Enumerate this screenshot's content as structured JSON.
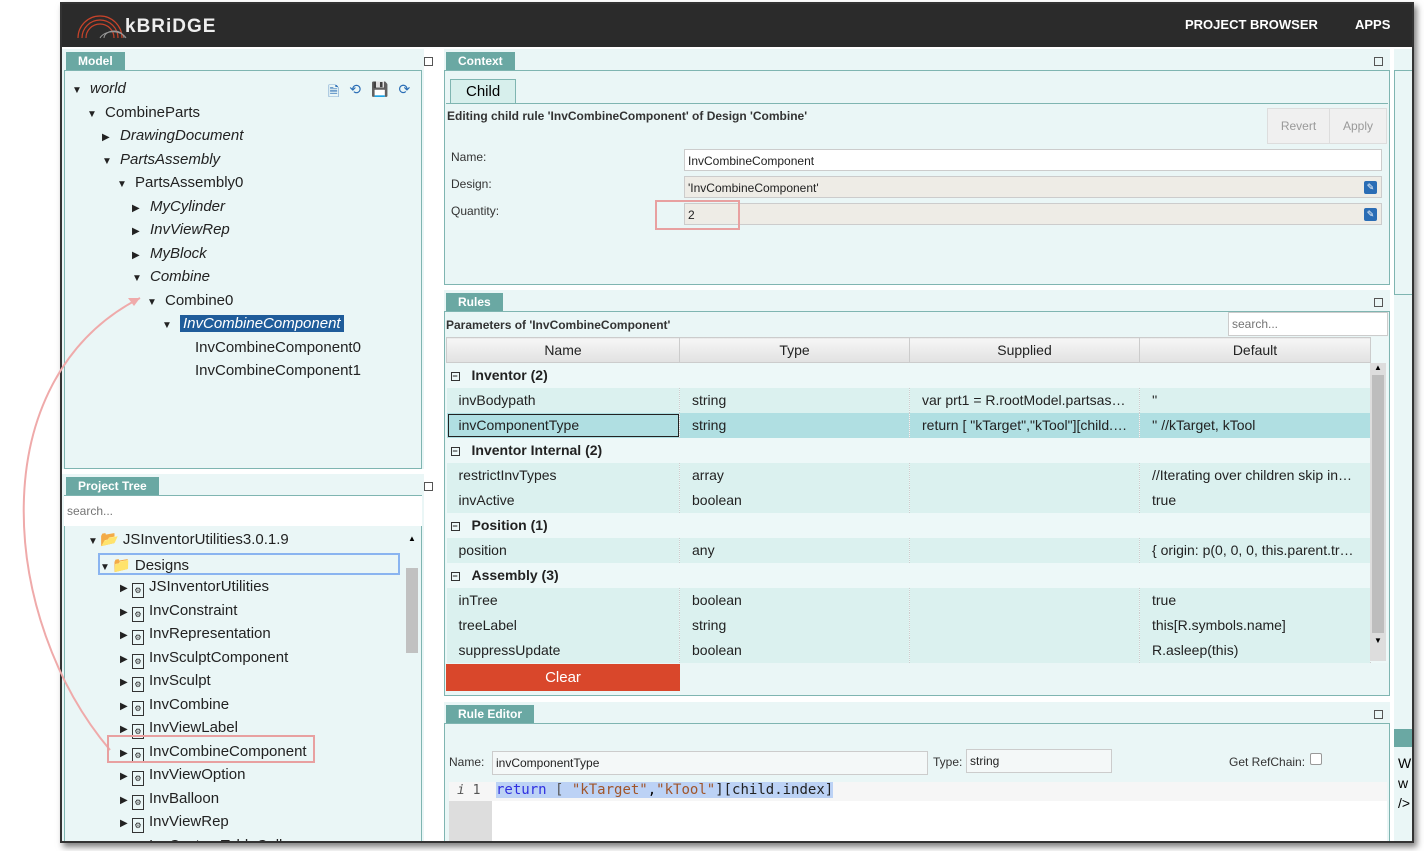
{
  "header": {
    "brand": "kBRiDGE",
    "nav": [
      "PROJECT BROWSER",
      "APPS"
    ]
  },
  "model": {
    "tab": "Model",
    "icons": [
      "code-file-icon",
      "history-icon",
      "save-icon",
      "refresh-icon"
    ],
    "nodes": [
      {
        "label": "world",
        "level": 0,
        "exp": "down",
        "italic": true
      },
      {
        "label": "CombineParts",
        "level": 1,
        "exp": "down"
      },
      {
        "label": "DrawingDocument",
        "level": 2,
        "exp": "right",
        "italic": true
      },
      {
        "label": "PartsAssembly",
        "level": 2,
        "exp": "down",
        "italic": true
      },
      {
        "label": "PartsAssembly0",
        "level": 3,
        "exp": "down"
      },
      {
        "label": "MyCylinder",
        "level": 4,
        "exp": "right",
        "italic": true
      },
      {
        "label": "InvViewRep",
        "level": 4,
        "exp": "right",
        "italic": true
      },
      {
        "label": "MyBlock",
        "level": 4,
        "exp": "right",
        "italic": true
      },
      {
        "label": "Combine",
        "level": 4,
        "exp": "down",
        "italic": true
      },
      {
        "label": "Combine0",
        "level": 5,
        "exp": "down"
      },
      {
        "label": "InvCombineComponent",
        "level": 6,
        "exp": "down",
        "selected": true
      },
      {
        "label": "InvCombineComponent0",
        "level": 7,
        "exp": ""
      },
      {
        "label": "InvCombineComponent1",
        "level": 7,
        "exp": ""
      }
    ]
  },
  "project_tree": {
    "tab": "Project Tree",
    "search_placeholder": "search...",
    "root": "JSInventorUtilities3.0.1.9",
    "folder": "Designs",
    "items": [
      "JSInventorUtilities",
      "InvConstraint",
      "InvRepresentation",
      "InvSculptComponent",
      "InvSculpt",
      "InvCombine",
      "InvViewLabel",
      "InvCombineComponent",
      "InvViewOption",
      "InvBalloon",
      "InvViewRep",
      "InvCustomTableCell"
    ]
  },
  "context": {
    "tab": "Context",
    "subtab": "Child",
    "heading": "Editing child rule 'InvCombineComponent' of Design 'Combine'",
    "revert": "Revert",
    "apply": "Apply",
    "fields": [
      {
        "label": "Name:",
        "value": "InvCombineComponent"
      },
      {
        "label": "Design:",
        "value": "'InvCombineComponent'"
      },
      {
        "label": "Quantity:",
        "value": "2"
      }
    ]
  },
  "rules": {
    "tab": "Rules",
    "heading": "Parameters of 'InvCombineComponent'",
    "search_placeholder": "search...",
    "columns": [
      "Name",
      "Type",
      "Supplied",
      "Default"
    ],
    "clear": "Clear",
    "rows": [
      {
        "group": "Inventor (2)"
      },
      {
        "cells": [
          "invBodypath",
          "string",
          "var prt1 = R.rootModel.partsas…",
          "''"
        ]
      },
      {
        "cells": [
          "invComponentType",
          "string",
          "return [ \"kTarget\",\"kTool\"][child.…",
          "'' //kTarget, kTool"
        ],
        "selected": true
      },
      {
        "group": "Inventor Internal (2)"
      },
      {
        "cells": [
          "restrictInvTypes",
          "array",
          "",
          "//Iterating over children skip in…"
        ]
      },
      {
        "cells": [
          "invActive",
          "boolean",
          "",
          "true"
        ]
      },
      {
        "group": "Position (1)"
      },
      {
        "cells": [
          "position",
          "any",
          "",
          "{ origin: p(0, 0, 0, this.parent.tr…"
        ]
      },
      {
        "group": "Assembly (3)"
      },
      {
        "cells": [
          "inTree",
          "boolean",
          "",
          "true"
        ]
      },
      {
        "cells": [
          "treeLabel",
          "string",
          "",
          "this[R.symbols.name]"
        ]
      },
      {
        "cells": [
          "suppressUpdate",
          "boolean",
          "",
          "R.asleep(this)"
        ]
      }
    ]
  },
  "rule_editor": {
    "tab": "Rule Editor",
    "name_label": "Name:",
    "name_value": "invComponentType",
    "type_label": "Type:",
    "type_value": "string",
    "refchain_label": "Get RefChain:",
    "line_no": "1",
    "code": {
      "kw": "return",
      "open": " [ ",
      "s1": "\"kTarget\"",
      "comma": ",",
      "s2": "\"kTool\"",
      "rest": "][child.index]"
    }
  },
  "right_peek": [
    "W",
    "w",
    "/>"
  ],
  "colors": {
    "tab": "#6aa8a3",
    "header": "#2b2b2b",
    "selected_row": "#b0dfe2",
    "clear_button": "#d9472b",
    "highlight": "#e8a0a0"
  }
}
